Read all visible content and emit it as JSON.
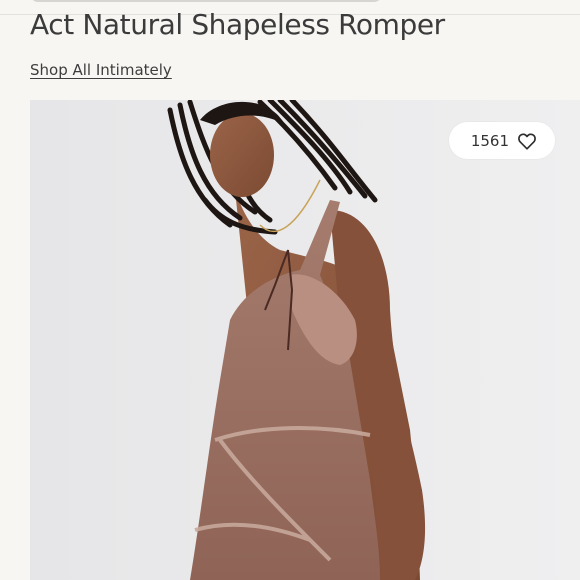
{
  "product": {
    "title": "Act Natural Shapeless Romper",
    "shop_link_label": "Shop All Intimately"
  },
  "likes": {
    "count": "1561",
    "icon": "heart-outline-icon"
  },
  "image": {
    "description_icon": "product-photo"
  },
  "colors": {
    "background": "#f7f6f3",
    "photo_background": "#e9e9ea",
    "garment": "#a57c6e",
    "text": "#3b3b3b"
  }
}
